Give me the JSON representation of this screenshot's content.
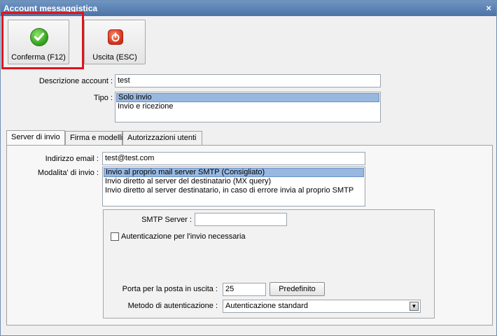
{
  "window": {
    "title": "Account messaggistica",
    "close_glyph": "×"
  },
  "toolbar": {
    "confirm_label": "Conferma (F12)",
    "exit_label": "Uscita (ESC)",
    "confirm_icon": "checkmark-icon",
    "exit_icon": "power-icon"
  },
  "account": {
    "description_label": "Descrizione account :",
    "description_value": "test",
    "type_label": "Tipo :",
    "type_options": [
      "Solo invio",
      "Invio e ricezione"
    ],
    "type_selected": "Solo invio"
  },
  "tabs": [
    "Server di invio",
    "Firma e modelli",
    "Autorizzazioni utenti"
  ],
  "server": {
    "email_label": "Indirizzo email :",
    "email_value": "test@test.com",
    "mode_label": "Modalita' di invio :",
    "mode_options": [
      "Invio al proprio mail server SMTP (Consigliato)",
      "Invio diretto al server del destinatario (MX query)",
      "Invio diretto al server destinatario, in caso di errore invia al proprio SMTP"
    ],
    "smtp_label": "SMTP Server :",
    "smtp_value": "",
    "auth_required_label": "Autenticazione per l'invio necessaria",
    "auth_required_checked": false,
    "port_label": "Porta per la posta in uscita :",
    "port_value": "25",
    "default_button": "Predefinito",
    "auth_method_label": "Metodo di autenticazione :",
    "auth_method_value": "Autenticazione standard"
  },
  "colors": {
    "highlight_box": "#e0141b",
    "selection": "#98b8e0",
    "titlebar": "#5a80b2"
  }
}
